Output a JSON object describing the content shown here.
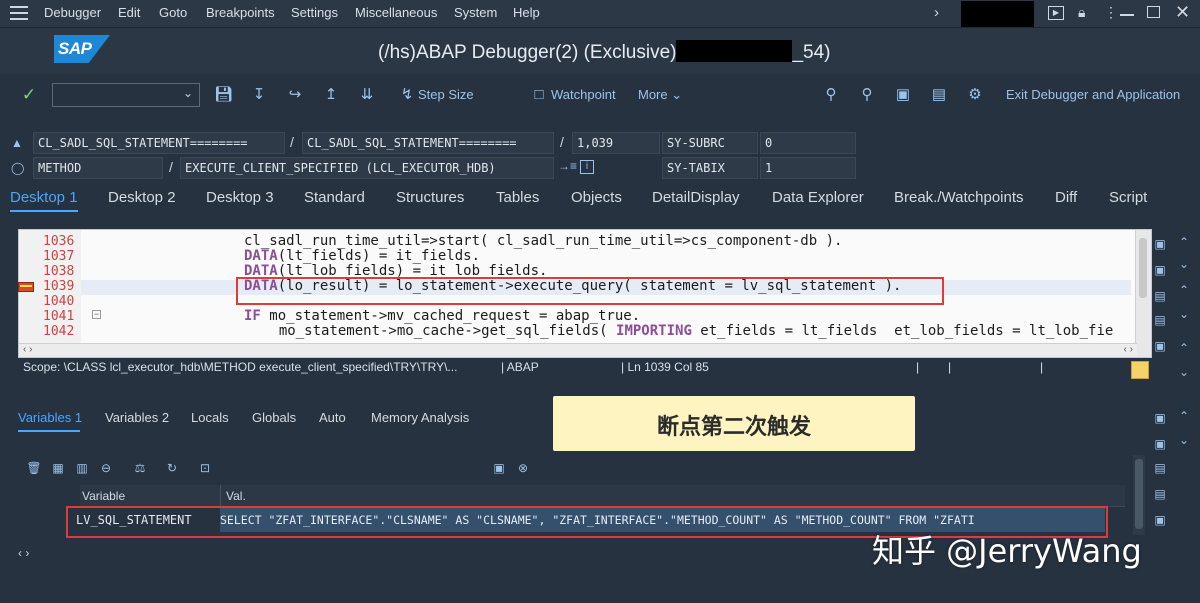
{
  "menu": {
    "items": [
      "Debugger",
      "Edit",
      "Goto",
      "Breakpoints",
      "Settings",
      "Miscellaneous",
      "System",
      "Help"
    ]
  },
  "window": {
    "title": "(/hs)ABAP Debugger(2)  (Exclusive)",
    "title_suffix": "_54)",
    "logo_text": "SAP"
  },
  "toolbar": {
    "step_size": "Step Size",
    "watchpoint": "Watchpoint",
    "more": "More",
    "exit": "Exit Debugger and Application"
  },
  "fields": {
    "program": "CL_SADL_SQL_STATEMENT========",
    "include": "CL_SADL_SQL_STATEMENT========",
    "line": "1,039",
    "subrc_label": "SY-SUBRC",
    "subrc_value": "0",
    "event_type": "METHOD",
    "event_name": "EXECUTE_CLIENT_SPECIFIED (LCL_EXECUTOR_HDB)",
    "tabix_label": "SY-TABIX",
    "tabix_value": "1"
  },
  "desktop_tabs": [
    "Desktop 1",
    "Desktop 2",
    "Desktop 3",
    "Standard",
    "Structures",
    "Tables",
    "Objects",
    "DetailDisplay",
    "Data Explorer",
    "Break./Watchpoints",
    "Diff",
    "Script"
  ],
  "editor": {
    "lines": [
      {
        "no": "1036",
        "kw": "",
        "text": "cl_sadl_run_time_util=>start( cl_sadl_run_time_util=>cs_component-db )."
      },
      {
        "no": "1037",
        "kw": "DATA",
        "text": "(lt_fields) = it_fields."
      },
      {
        "no": "1038",
        "kw": "DATA",
        "text": "(lt_lob_fields) = it_lob_fields."
      },
      {
        "no": "1039",
        "kw": "DATA",
        "text": "(lo_result) = lo_statement->execute_query( statement = lv_sql_statement )."
      },
      {
        "no": "1040",
        "kw": "",
        "text": ""
      },
      {
        "no": "1041",
        "kw": "IF",
        "text": " mo_statement->mv_cached_request = abap_true."
      },
      {
        "no": "1042",
        "kw": "",
        "text": "  mo_statement->mo_cache->get_sql_fields( "
      },
      {
        "no": "1042b",
        "kw": "IMPORTING",
        "text": " et_fields = lt_fields  et_lob_fields = lt_lob_fie"
      }
    ]
  },
  "status": {
    "scope": "Scope: \\CLASS lcl_executor_hdb\\METHOD execute_client_specified\\TRY\\TRY\\...",
    "lang": "| ABAP",
    "pos": "| Ln 1039 Col  85"
  },
  "var_tabs": [
    "Variables 1",
    "Variables 2",
    "Locals",
    "Globals",
    "Auto",
    "Memory Analysis"
  ],
  "annotation": "断点第二次触发",
  "variables": {
    "col_variable": "Variable",
    "col_value": "Val.",
    "rows": [
      {
        "name": "LV_SQL_STATEMENT",
        "value": "SELECT \"ZFAT_INTERFACE\".\"CLSNAME\" AS \"CLSNAME\", \"ZFAT_INTERFACE\".\"METHOD_COUNT\" AS \"METHOD_COUNT\" FROM \"ZFATI"
      }
    ]
  },
  "watermark": "知乎 @JerryWang",
  "colors": {
    "background": "#26323f",
    "accent": "#4aa6ff",
    "highlight_box": "#e03b3b",
    "annotation_bg": "#fdf4c2"
  }
}
